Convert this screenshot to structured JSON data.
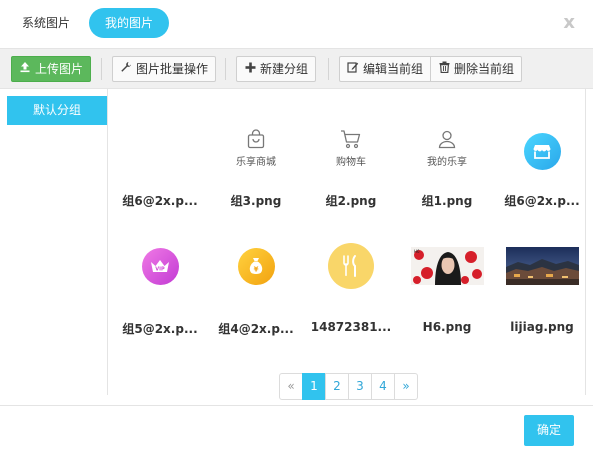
{
  "tabs": {
    "system_label": "系统图片",
    "mine_label": "我的图片"
  },
  "close_label": "x",
  "toolbar": {
    "upload_label": "上传图片",
    "batch_label": "图片批量操作",
    "new_group_label": "新建分组",
    "edit_group_label": "编辑当前组",
    "delete_group_label": "删除当前组"
  },
  "sidebar": {
    "items": [
      {
        "label": "默认分组",
        "active": true
      }
    ]
  },
  "gallery": {
    "items": [
      {
        "name": "组6@2x.p...",
        "kind": "blank"
      },
      {
        "name": "组3.png",
        "kind": "outline",
        "icon": "shopping-bag-icon",
        "caption": "乐享商城"
      },
      {
        "name": "组2.png",
        "kind": "outline",
        "icon": "shopping-cart-icon",
        "caption": "购物车"
      },
      {
        "name": "组1.png",
        "kind": "outline",
        "icon": "user-icon",
        "caption": "我的乐享"
      },
      {
        "name": "组6@2x.p...",
        "kind": "circle",
        "icon": "store-icon",
        "color": "#31c3ee"
      },
      {
        "name": "组5@2x.p...",
        "kind": "circle",
        "icon": "vip-crown-icon",
        "color": "#e35ad8",
        "badge": "VIP"
      },
      {
        "name": "组4@2x.p...",
        "kind": "circle",
        "icon": "money-bag-icon",
        "color": "#f6b21e"
      },
      {
        "name": "14872381...",
        "kind": "circle",
        "icon": "fork-knife-icon",
        "color": "#f9d669"
      },
      {
        "name": "H6.png",
        "kind": "photo",
        "icon": "portrait-photo"
      },
      {
        "name": "lijiag.png",
        "kind": "photo",
        "icon": "landscape-photo"
      }
    ]
  },
  "pagination": {
    "prev_label": "«",
    "pages": [
      "1",
      "2",
      "3",
      "4"
    ],
    "active_page": "1",
    "next_label": "»"
  },
  "footer": {
    "confirm_label": "确定"
  },
  "colors": {
    "accent": "#31c3ee",
    "upload_green": "#5cb85c"
  }
}
